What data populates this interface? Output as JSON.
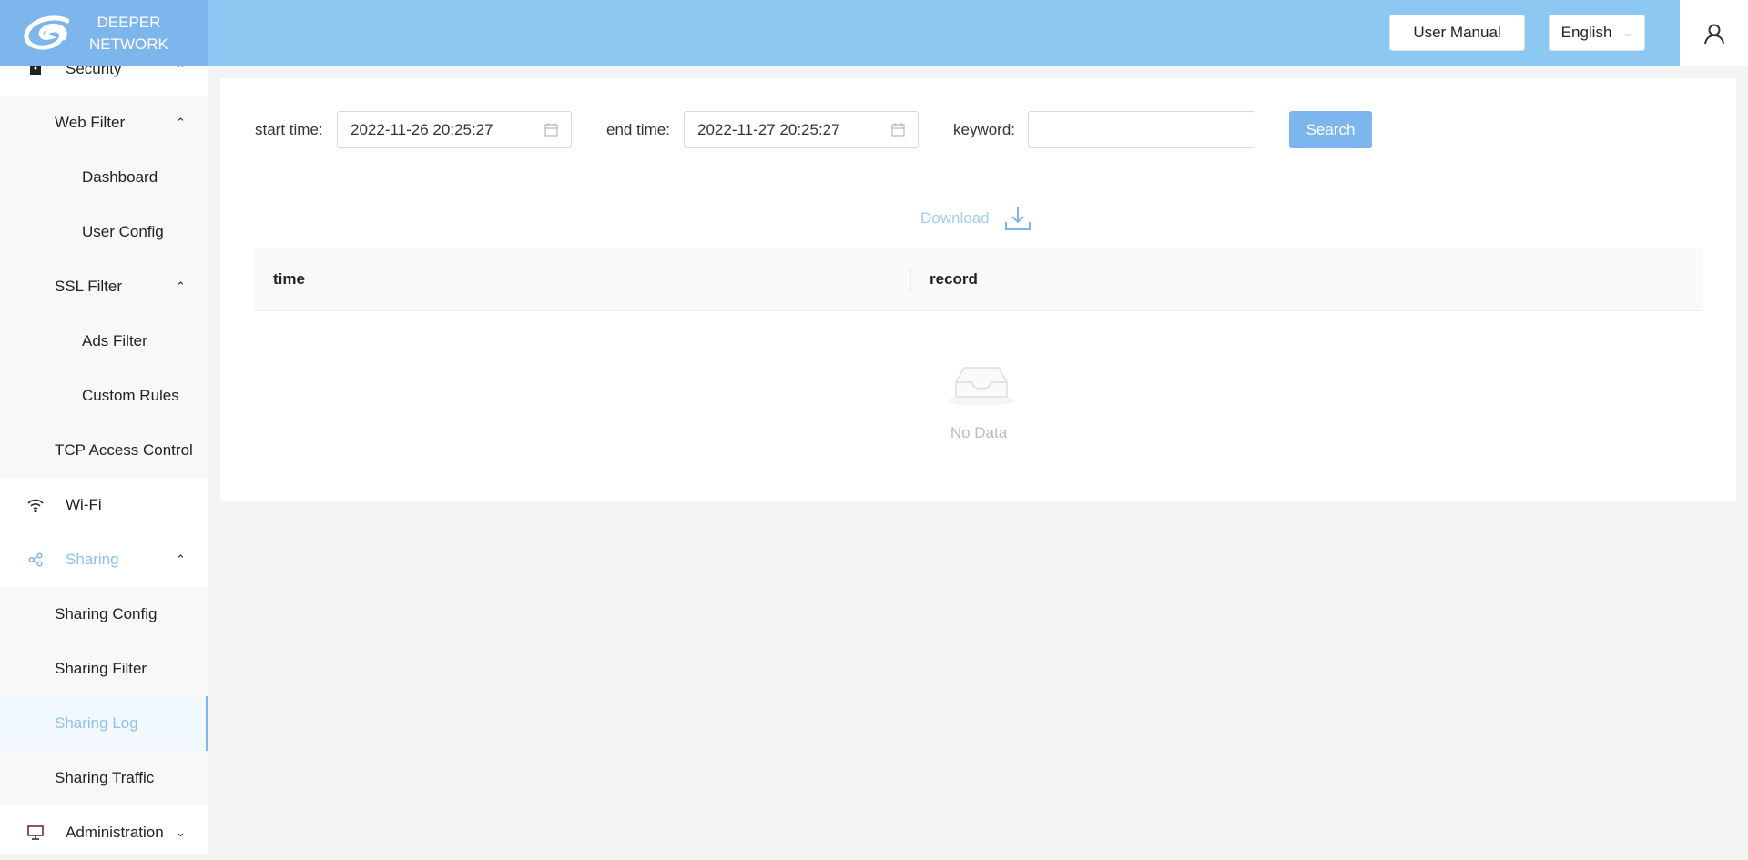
{
  "header": {
    "logo_line1": "DEEPER",
    "logo_line2": "NETWORK",
    "user_manual": "User Manual",
    "language": "English"
  },
  "sidebar": {
    "items": [
      {
        "label": "Security",
        "icon": "lock-icon",
        "expanded": true
      },
      {
        "label": "Web Filter",
        "expanded": true
      },
      {
        "label": "Dashboard"
      },
      {
        "label": "User Config"
      },
      {
        "label": "SSL Filter",
        "expanded": true
      },
      {
        "label": "Ads Filter"
      },
      {
        "label": "Custom Rules"
      },
      {
        "label": "TCP Access Control"
      },
      {
        "label": "Wi-Fi",
        "icon": "wifi-icon"
      },
      {
        "label": "Sharing",
        "icon": "share-icon",
        "expanded": true
      },
      {
        "label": "Sharing Config"
      },
      {
        "label": "Sharing Filter"
      },
      {
        "label": "Sharing Log",
        "active": true
      },
      {
        "label": "Sharing Traffic"
      },
      {
        "label": "Administration",
        "icon": "monitor-icon",
        "expanded": false
      }
    ]
  },
  "filters": {
    "start_label": "start time:",
    "start_value": "2022-11-26 20:25:27",
    "end_label": "end time:",
    "end_value": "2022-11-27 20:25:27",
    "keyword_label": "keyword:",
    "keyword_value": "",
    "search": "Search"
  },
  "download": "Download",
  "table": {
    "columns": [
      "time",
      "record"
    ],
    "empty": "No Data"
  },
  "colors": {
    "accent": "#7db6ec",
    "header": "#8dc8f3"
  }
}
